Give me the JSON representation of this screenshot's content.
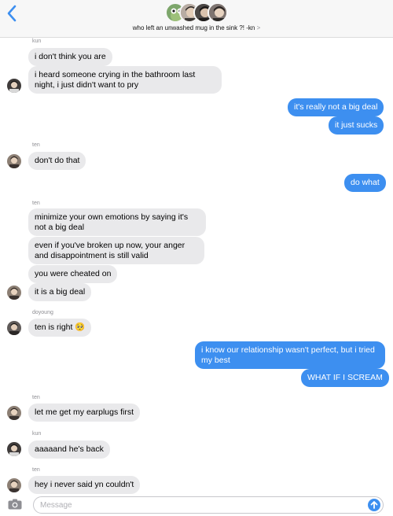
{
  "header": {
    "back_label": "<",
    "title": "who left an unwashed mug in the sink ?! -kn",
    "chevron": ">"
  },
  "senders": {
    "kun": "kun",
    "ten": "ten",
    "doyoung": "doyoung"
  },
  "messages": [
    {
      "text": "i don't think you are"
    },
    {
      "text": "i heard someone crying in the bathroom last night, i just didn't want to pry"
    },
    {
      "text": "it's really not a big deal"
    },
    {
      "text": "it just sucks"
    },
    {
      "text": "don't do that"
    },
    {
      "text": "do what"
    },
    {
      "text": "minimize your own emotions by saying it's not a big deal"
    },
    {
      "text": "even if you've broken up now, your anger and disappointment is still valid"
    },
    {
      "text": "you were cheated on"
    },
    {
      "text": "it is a big deal"
    },
    {
      "text": "ten is right 🥺"
    },
    {
      "text": "i know our relationship wasn't perfect, but i tried my best"
    },
    {
      "text": "WHAT IF I SCREAM"
    },
    {
      "text": "let me get my earplugs first"
    },
    {
      "text": "aaaaand he's back"
    },
    {
      "text": "hey i never said yn couldn't"
    }
  ],
  "input": {
    "placeholder": "Message",
    "value": ""
  },
  "colors": {
    "outgoing": "#3d8ff0",
    "incoming": "#e9e9eb",
    "accent": "#3d8ff0"
  },
  "icons": [
    "back-chevron-icon",
    "camera-icon",
    "send-arrow-icon",
    "avatar"
  ]
}
